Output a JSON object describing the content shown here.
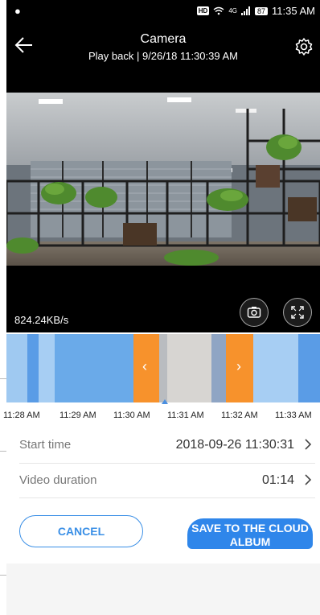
{
  "status_bar": {
    "time": "11:35 AM",
    "battery": "87",
    "network": "4G"
  },
  "header": {
    "title": "Camera",
    "subtitle": "Play back | 9/26/18 11:30:39 AM"
  },
  "video": {
    "bitrate": "824.24KB/s"
  },
  "timeline": {
    "labels": [
      "11:28 AM",
      "11:29 AM",
      "11:30 AM",
      "11:31 AM",
      "11:32 AM",
      "11:33 AM"
    ],
    "prev_arrow": "‹",
    "next_arrow": "›"
  },
  "details": {
    "start_time_label": "Start time",
    "start_time_value": "2018-09-26 11:30:31",
    "duration_label": "Video duration",
    "duration_value": "01:14"
  },
  "actions": {
    "cancel_label": "CANCEL",
    "save_label": "SAVE TO THE CLOUD ALBUM"
  },
  "colors": {
    "accent": "#2f86ea",
    "timeline_blue": "#6aaae9",
    "selection_orange": "#f7922c",
    "selection_gray": "#d7d5d2"
  },
  "icons": [
    "back-arrow-icon",
    "gear-icon",
    "camera-snapshot-icon",
    "fullscreen-icon",
    "chevron-right-icon"
  ]
}
